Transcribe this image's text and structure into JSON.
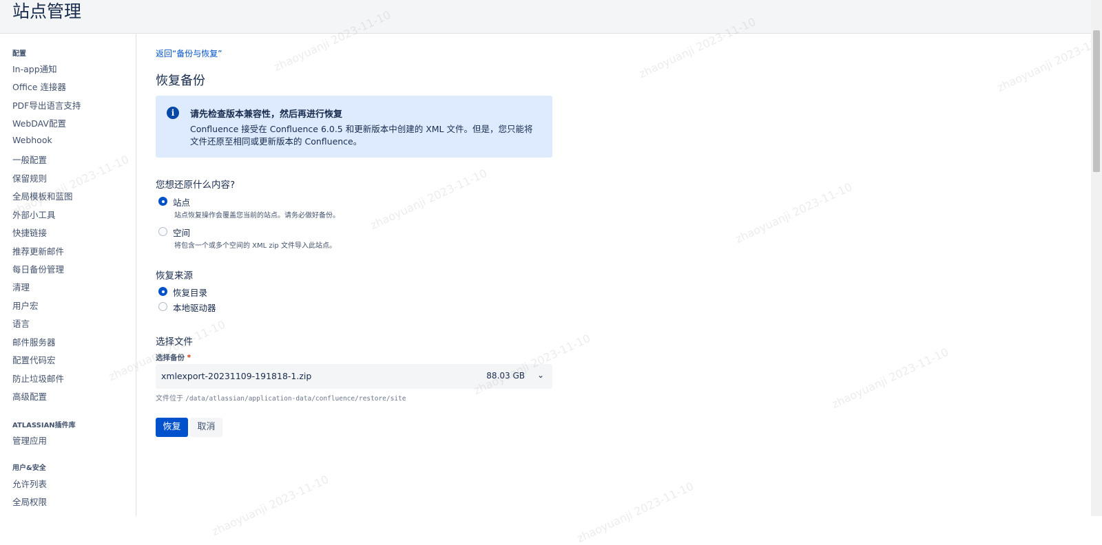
{
  "header": {
    "title": "站点管理"
  },
  "sidebar": {
    "section_config": "配置",
    "config_items": [
      "In-app通知",
      "Office 连接器",
      "PDF导出语言支持",
      "WebDAV配置",
      "Webhook",
      "一般配置",
      "保留规则",
      "全局模板和蓝图",
      "外部小工具",
      "快捷链接",
      "推荐更新邮件",
      "每日备份管理",
      "清理",
      "用户宏",
      "语言",
      "邮件服务器",
      "配置代码宏",
      "防止垃圾邮件",
      "高级配置"
    ],
    "section_plugins": "ATLASSIAN插件库",
    "plugin_items": [
      "管理应用"
    ],
    "section_security": "用户&安全",
    "security_items": [
      "允许列表",
      "全局权限"
    ]
  },
  "main": {
    "back_link": "返回“备份与恢复”",
    "title": "恢复备份",
    "info": {
      "icon": "info-icon",
      "title": "请先检查版本兼容性，然后再进行恢复",
      "text": "Confluence 接受在 Confluence 6.0.5 和更新版本中创建的 XML 文件。但是，您只能将文件还原至相同或更新版本的 Confluence。"
    },
    "restore_what": {
      "label": "您想还原什么内容?",
      "options": [
        {
          "label": "站点",
          "desc": "站点恢复操作会覆盖您当前的站点。请务必做好备份。",
          "checked": true
        },
        {
          "label": "空间",
          "desc": "将包含一个或多个空间的 XML zip 文件导入此站点。",
          "checked": false
        }
      ]
    },
    "restore_source": {
      "label": "恢复来源",
      "options": [
        {
          "label": "恢复目录",
          "checked": true
        },
        {
          "label": "本地驱动器",
          "checked": false
        }
      ]
    },
    "file": {
      "section_label": "选择文件",
      "field_label": "选择备份",
      "required_mark": "*",
      "selected_file": "xmlexport-20231109-191818-1.zip",
      "file_size": "88.03 GB",
      "path_prefix": "文件位于",
      "path": "/data/atlassian/application-data/confluence/restore/site"
    },
    "buttons": {
      "restore": "恢复",
      "cancel": "取消"
    }
  },
  "watermark": "zhaoyuanji 2023-11-10",
  "colors": {
    "primary": "#0052cc",
    "info_bg": "#deebff",
    "text": "#172b4d"
  }
}
